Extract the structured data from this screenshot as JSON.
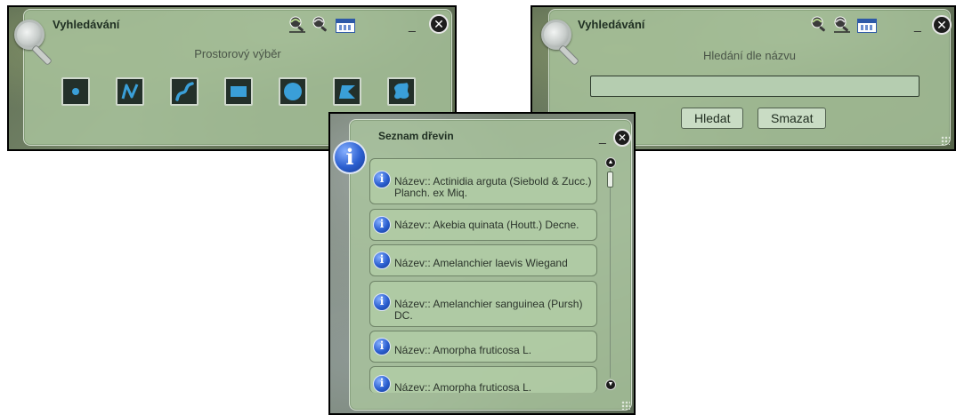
{
  "search_panel": {
    "title": "Vyhledávání",
    "subtitle": "Prostorový výběr",
    "tools": [
      {
        "name": "point-tool",
        "icon": "point-icon"
      },
      {
        "name": "polyline-tool",
        "icon": "polyline-icon"
      },
      {
        "name": "freehand-line-tool",
        "icon": "freehand-line-icon"
      },
      {
        "name": "rectangle-tool",
        "icon": "rectangle-icon"
      },
      {
        "name": "circle-tool",
        "icon": "circle-icon"
      },
      {
        "name": "polygon-tool",
        "icon": "polygon-icon"
      },
      {
        "name": "freehand-polygon-tool",
        "icon": "freehand-polygon-icon"
      }
    ],
    "header_icons": [
      "spatial-search-icon",
      "name-search-icon",
      "calendar-icon"
    ],
    "minimize": "_",
    "close": "✕"
  },
  "name_search_panel": {
    "title": "Vyhledávání",
    "subtitle": "Hledání dle názvu",
    "input_value": "",
    "search_button": "Hledat",
    "clear_button": "Smazat",
    "minimize": "_",
    "close": "✕"
  },
  "tree_list_panel": {
    "title": "Seznam dřevin",
    "minimize": "_",
    "close": "✕",
    "items": [
      {
        "label": "Název:: Actinidia arguta (Siebold & Zucc.) Planch. ex Miq."
      },
      {
        "label": "Název:: Akebia quinata (Houtt.) Decne."
      },
      {
        "label": "Název:: Amelanchier laevis Wiegand"
      },
      {
        "label": "Název:: Amelanchier sanguinea (Pursh) DC."
      },
      {
        "label": "Název:: Amorpha fruticosa L."
      },
      {
        "label": "Název:: Amorpha fruticosa L."
      }
    ]
  },
  "colors": {
    "panel_bg": "#aac49e",
    "tool_button_bg": "#23302a",
    "tool_shape": "#3a9fd8",
    "info_blue": "#2b5fd0"
  }
}
